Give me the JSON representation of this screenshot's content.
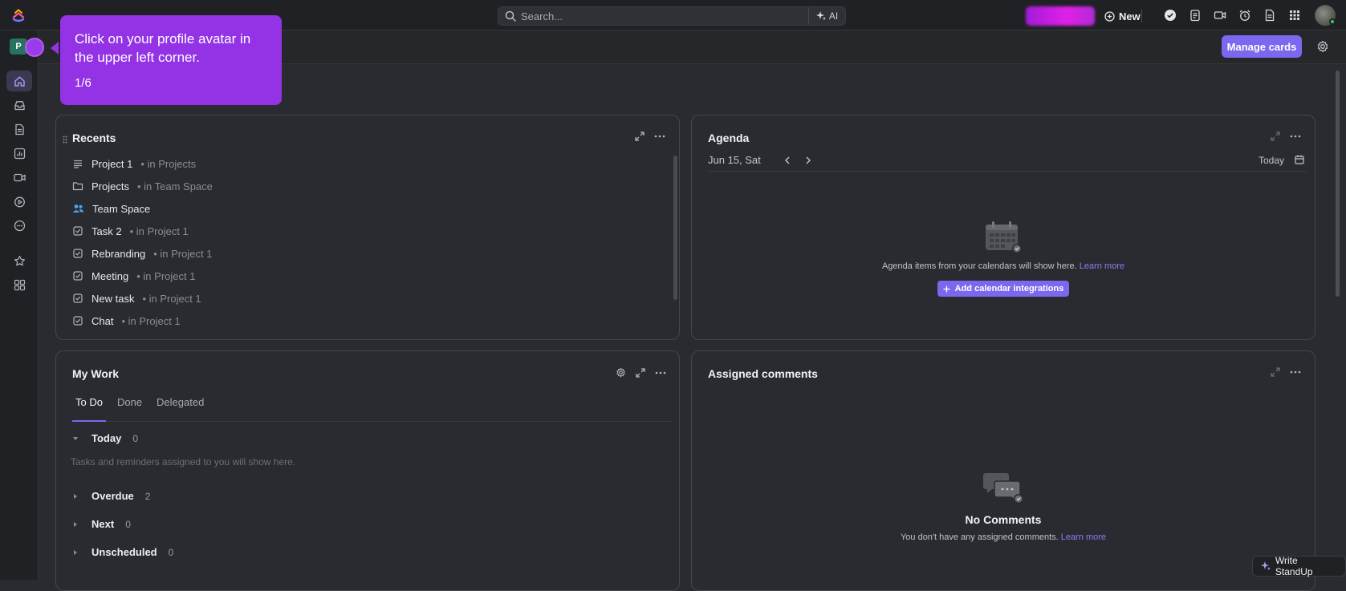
{
  "topbar": {
    "search_placeholder": "Search...",
    "ai_label": "AI",
    "new_label": "New"
  },
  "sidebar": {
    "workspace_initial": "P"
  },
  "header": {
    "manage_cards_label": "Manage cards"
  },
  "tour": {
    "text": "Click on your profile avatar in the upper left corner.",
    "step": "1/6"
  },
  "recents": {
    "title": "Recents",
    "items": [
      {
        "name": "Project 1",
        "location": "• in Projects",
        "icon": "list-icon"
      },
      {
        "name": "Projects",
        "location": "• in Team Space",
        "icon": "folder-icon"
      },
      {
        "name": "Team Space",
        "location": "",
        "icon": "team-icon"
      },
      {
        "name": "Task 2",
        "location": "• in Project 1",
        "icon": "task-icon"
      },
      {
        "name": "Rebranding",
        "location": "• in Project 1",
        "icon": "task-icon"
      },
      {
        "name": "Meeting",
        "location": "• in Project 1",
        "icon": "task-icon"
      },
      {
        "name": "New task",
        "location": "• in Project 1",
        "icon": "task-icon"
      },
      {
        "name": "Chat",
        "location": "• in Project 1",
        "icon": "task-icon"
      }
    ]
  },
  "agenda": {
    "title": "Agenda",
    "date": "Jun 15, Sat",
    "today_label": "Today",
    "empty_text": "Agenda items from your calendars will show here.",
    "learn_more": "Learn more",
    "add_button": "Add calendar integrations"
  },
  "mywork": {
    "title": "My Work",
    "tabs": [
      "To Do",
      "Done",
      "Delegated"
    ],
    "hint": "Tasks and reminders assigned to you will show here.",
    "groups": [
      {
        "name": "Today",
        "count": "0"
      },
      {
        "name": "Overdue",
        "count": "2"
      },
      {
        "name": "Next",
        "count": "0"
      },
      {
        "name": "Unscheduled",
        "count": "0"
      }
    ]
  },
  "comments": {
    "title": "Assigned comments",
    "empty_title": "No Comments",
    "empty_text": "You don't have any assigned comments.",
    "learn_more": "Learn more"
  },
  "standup": {
    "label": "Write StandUp"
  },
  "colors": {
    "accent": "#7b68ee",
    "tour": "#9333e5",
    "background": "#2a2b30"
  }
}
